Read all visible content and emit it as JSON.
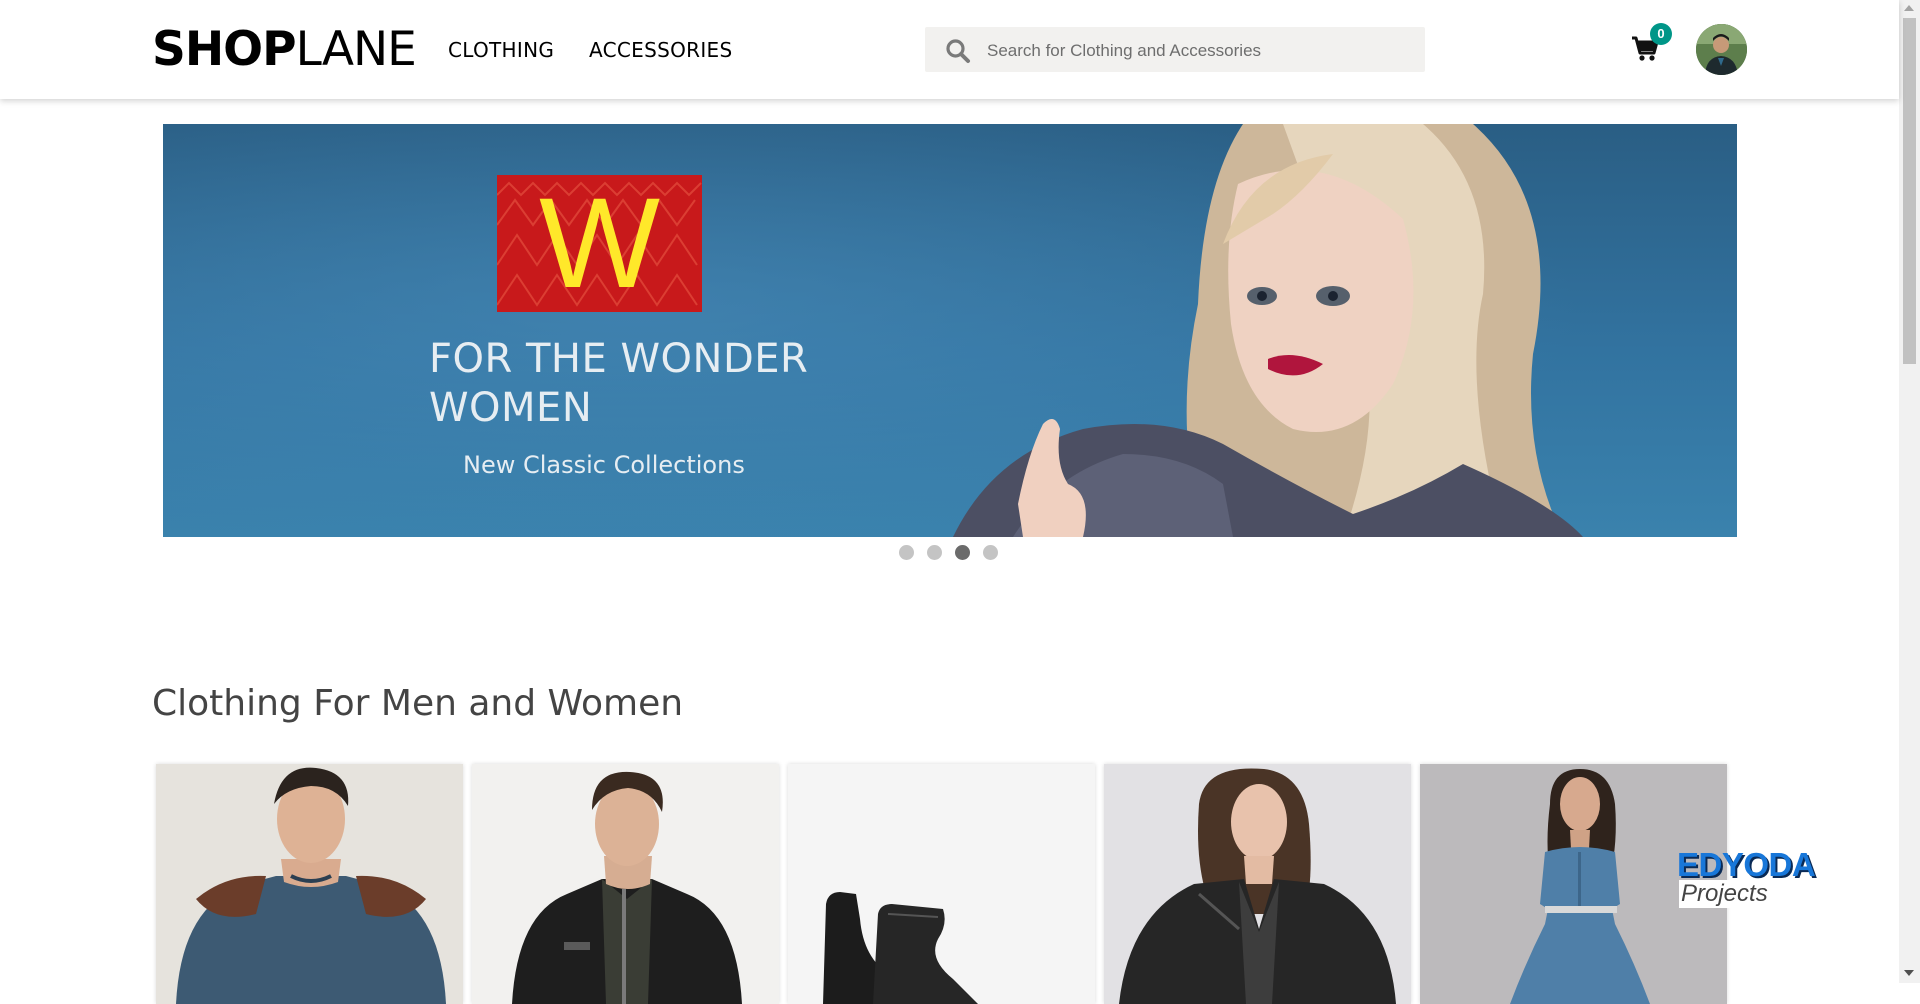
{
  "header": {
    "logo_bold": "SHOP",
    "logo_light": "LANE",
    "nav": [
      "CLOTHING",
      "ACCESSORIES"
    ],
    "search_placeholder": "Search for Clothing and Accessories",
    "cart_count": "0",
    "accent_color": "#009688"
  },
  "banner": {
    "logo_letter": "W",
    "headline": "FOR THE WONDER WOMEN",
    "subline": "New Classic Collections",
    "slide_count": 4,
    "active_slide": 3
  },
  "section": {
    "title": "Clothing For Men and Women"
  },
  "products": [
    {
      "kind": "men-sweater"
    },
    {
      "kind": "men-jacket"
    },
    {
      "kind": "ankle-boots"
    },
    {
      "kind": "women-leather-jacket"
    },
    {
      "kind": "women-denim-dress"
    }
  ],
  "watermark": {
    "brand": "EDYODA",
    "tag": "Projects"
  }
}
